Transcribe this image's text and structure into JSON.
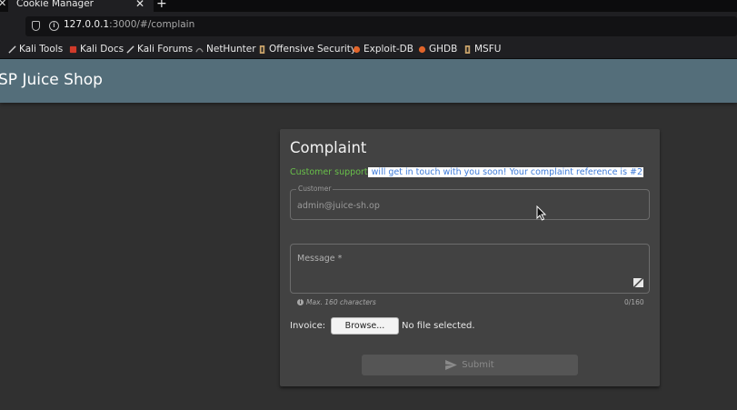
{
  "browser": {
    "tab_title": "Cookie Manager",
    "url_host": "127.0.0.1",
    "url_rest": ":3000/#/complain",
    "bookmarks": [
      {
        "label": "Kali Tools",
        "icon": "kali-dragon-icon",
        "color": "#cfcfcf"
      },
      {
        "label": "Kali Docs",
        "icon": "kali-docs-icon",
        "color": "#d03a2a"
      },
      {
        "label": "Kali Forums",
        "icon": "kali-dragon-icon",
        "color": "#cfcfcf"
      },
      {
        "label": "NetHunter",
        "icon": "nethunter-icon",
        "color": "#8a8a8a"
      },
      {
        "label": "Offensive Security",
        "icon": "offsec-icon",
        "color": "#c9a36a"
      },
      {
        "label": "Exploit-DB",
        "icon": "exploitdb-icon",
        "color": "#e0642a"
      },
      {
        "label": "GHDB",
        "icon": "ghdb-icon",
        "color": "#e0642a"
      },
      {
        "label": "MSFU",
        "icon": "msfu-icon",
        "color": "#c9a36a"
      }
    ]
  },
  "app": {
    "title": "SP Juice Shop",
    "toolbar_color": "#546e7a"
  },
  "complaint": {
    "title": "Complaint",
    "confirm_green": "Customer support",
    "confirm_selected": " will get in touch with you soon! Your complaint reference is #2",
    "customer_label": "Customer",
    "customer_value": "admin@juice-sh.op",
    "message_label": "Message *",
    "hint": "Max. 160 characters",
    "counter": "0/160",
    "invoice_label": "Invoice:",
    "browse_label": "Browse...",
    "no_file": "No file selected.",
    "submit_label": "Submit"
  }
}
